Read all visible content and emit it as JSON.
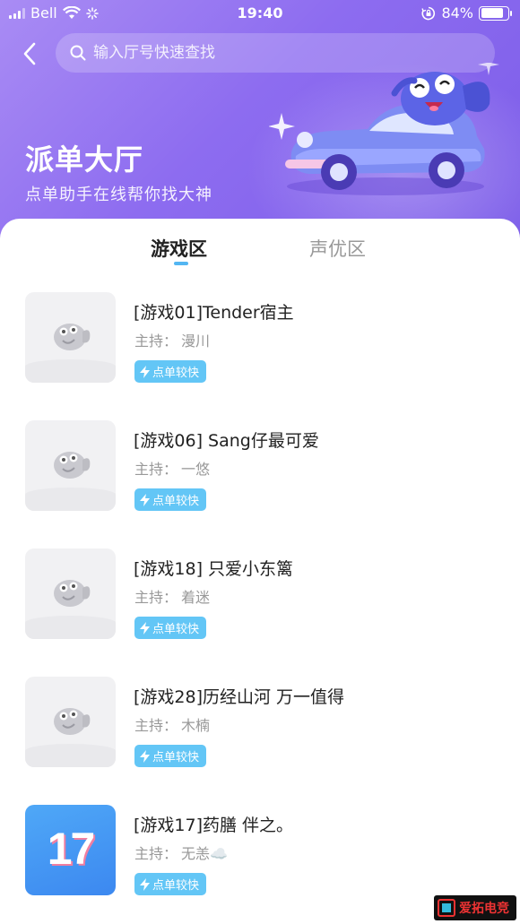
{
  "status_bar": {
    "carrier": "Bell",
    "time": "19:40",
    "battery": "84%",
    "battery_level": 0.84
  },
  "header": {
    "search_placeholder": "输入厅号快速查找",
    "title": "派单大厅",
    "subtitle": "点单助手在线帮你找大神"
  },
  "tabs": [
    {
      "label": "游戏区",
      "active": true
    },
    {
      "label": "声优区",
      "active": false
    }
  ],
  "rooms": [
    {
      "title": "[游戏01]Tender宿主",
      "host_prefix": "主持：",
      "host": "漫川",
      "badge": "点单较快",
      "thumb": "placeholder-fish-icon"
    },
    {
      "title": "[游戏06] Sang仔最可爱",
      "host_prefix": "主持：",
      "host": "一悠",
      "badge": "点单较快",
      "thumb": "placeholder-fish-icon"
    },
    {
      "title": "[游戏18] 只爱小东篱",
      "host_prefix": "主持：",
      "host": "着迷",
      "badge": "点单较快",
      "thumb": "placeholder-fish-icon"
    },
    {
      "title": "[游戏28]历经山河 万一值得",
      "host_prefix": "主持：",
      "host": "木楠",
      "badge": "点单较快",
      "thumb": "placeholder-fish-icon"
    },
    {
      "title": "[游戏17]药膳 伴之。",
      "host_prefix": "主持：",
      "host": "无恙☁️",
      "badge": "点单较快",
      "thumb_text": "17"
    }
  ],
  "watermark": {
    "text": "爱拓电竞"
  },
  "colors": {
    "hero_start": "#a98cf4",
    "hero_end": "#7b5ce8",
    "accent": "#53b6f2",
    "badge": "#63c6f6"
  }
}
